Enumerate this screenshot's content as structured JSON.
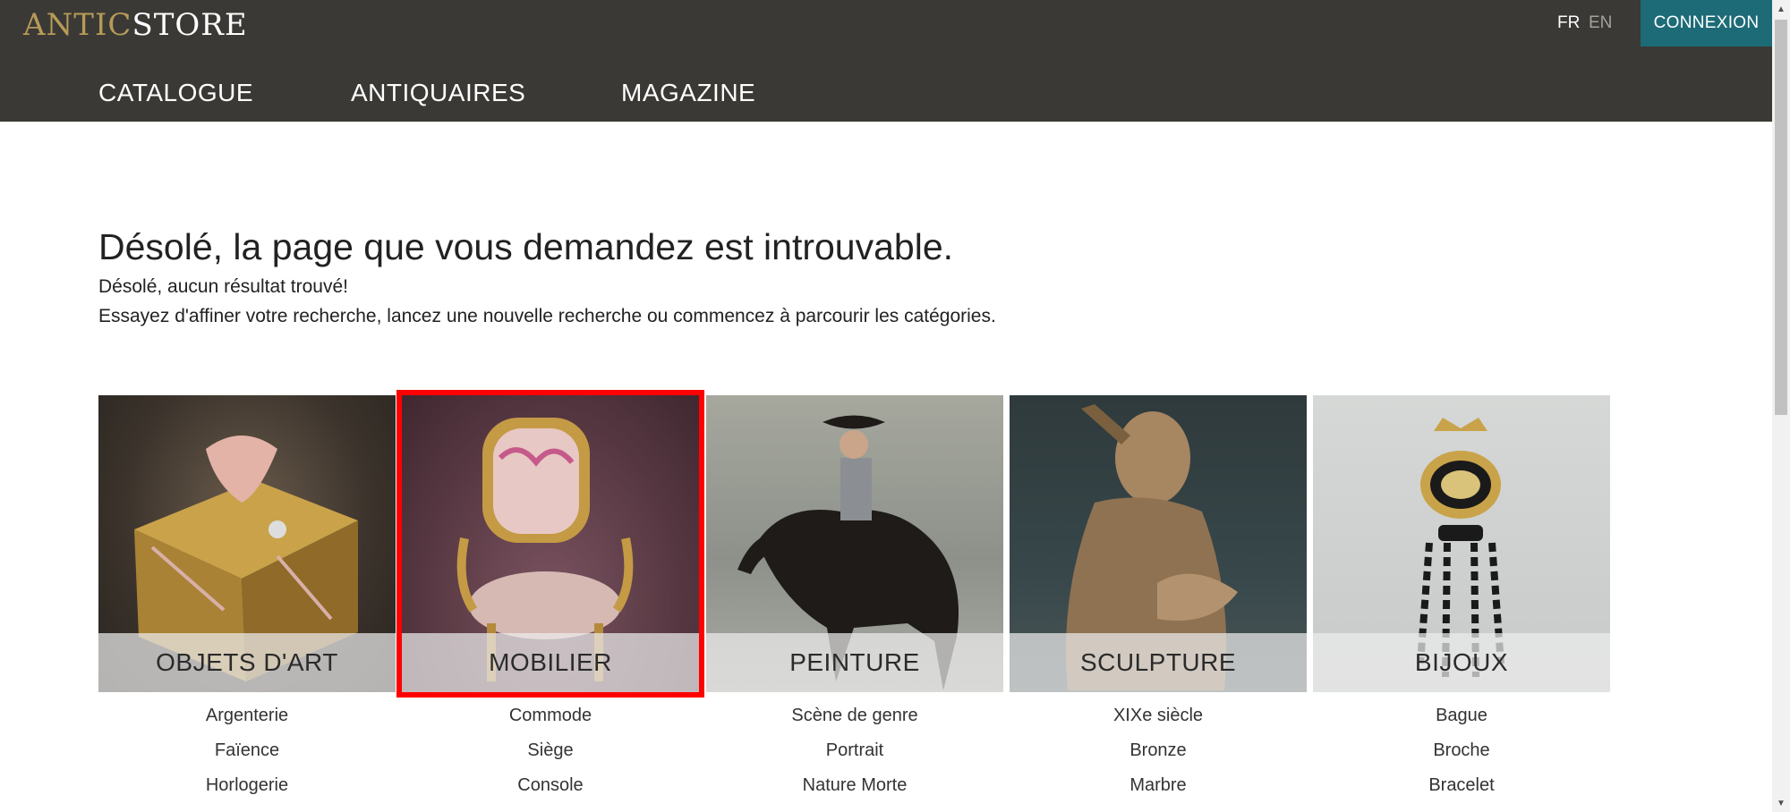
{
  "header": {
    "logo_part1": "ANTIC",
    "logo_part2": "STORE",
    "lang_fr": "FR",
    "lang_en": "EN",
    "login": "CONNEXION",
    "nav": [
      "CATALOGUE",
      "ANTIQUAIRES",
      "MAGAZINE"
    ]
  },
  "main": {
    "title": "Désolé, la page que vous demandez est introuvable.",
    "line1": "Désolé, aucun résultat trouvé!",
    "line2": "Essayez d'affiner votre recherche, lancez une nouvelle recherche ou commencez à parcourir les catégories."
  },
  "categories": [
    {
      "name": "OBJETS D'ART",
      "subs": [
        "Argenterie",
        "Faïence",
        "Horlogerie"
      ]
    },
    {
      "name": "MOBILIER",
      "subs": [
        "Commode",
        "Siège",
        "Console"
      ]
    },
    {
      "name": "PEINTURE",
      "subs": [
        "Scène de genre",
        "Portrait",
        "Nature Morte"
      ]
    },
    {
      "name": "SCULPTURE",
      "subs": [
        "XIXe siècle",
        "Bronze",
        "Marbre"
      ]
    },
    {
      "name": "BIJOUX",
      "subs": [
        "Bague",
        "Broche",
        "Bracelet"
      ]
    }
  ],
  "colors": {
    "header_bg": "#3a3935",
    "logo_gold": "#b69a58",
    "login_bg": "#1d6b77",
    "highlight": "#ff0000"
  }
}
